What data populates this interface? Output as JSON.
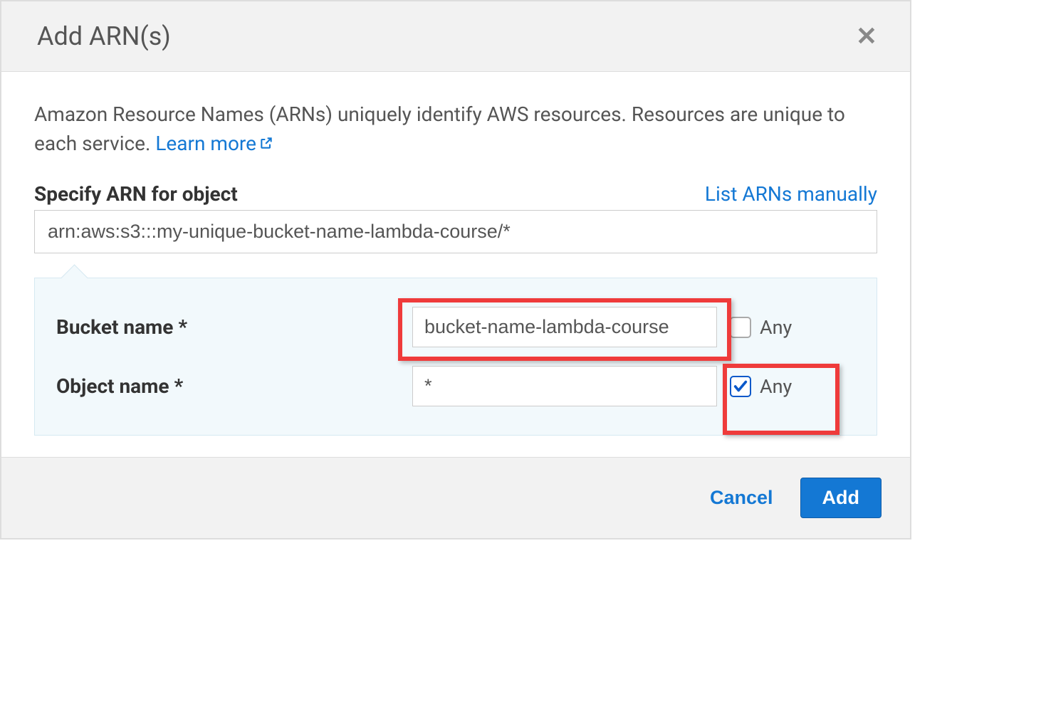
{
  "header": {
    "title": "Add ARN(s)"
  },
  "body": {
    "description_prefix": "Amazon Resource Names (ARNs) uniquely identify AWS resources. Resources are unique to each service. ",
    "learn_more_label": "Learn more",
    "specify_label": "Specify ARN for object",
    "list_manually_label": "List ARNs manually",
    "arn_value": "arn:aws:s3:::my-unique-bucket-name-lambda-course/*",
    "fields": {
      "bucket": {
        "label": "Bucket name *",
        "value": "bucket-name-lambda-course",
        "any_label": "Any",
        "any_checked": false
      },
      "object": {
        "label": "Object name *",
        "value": "*",
        "any_label": "Any",
        "any_checked": true
      }
    }
  },
  "footer": {
    "cancel_label": "Cancel",
    "add_label": "Add"
  }
}
